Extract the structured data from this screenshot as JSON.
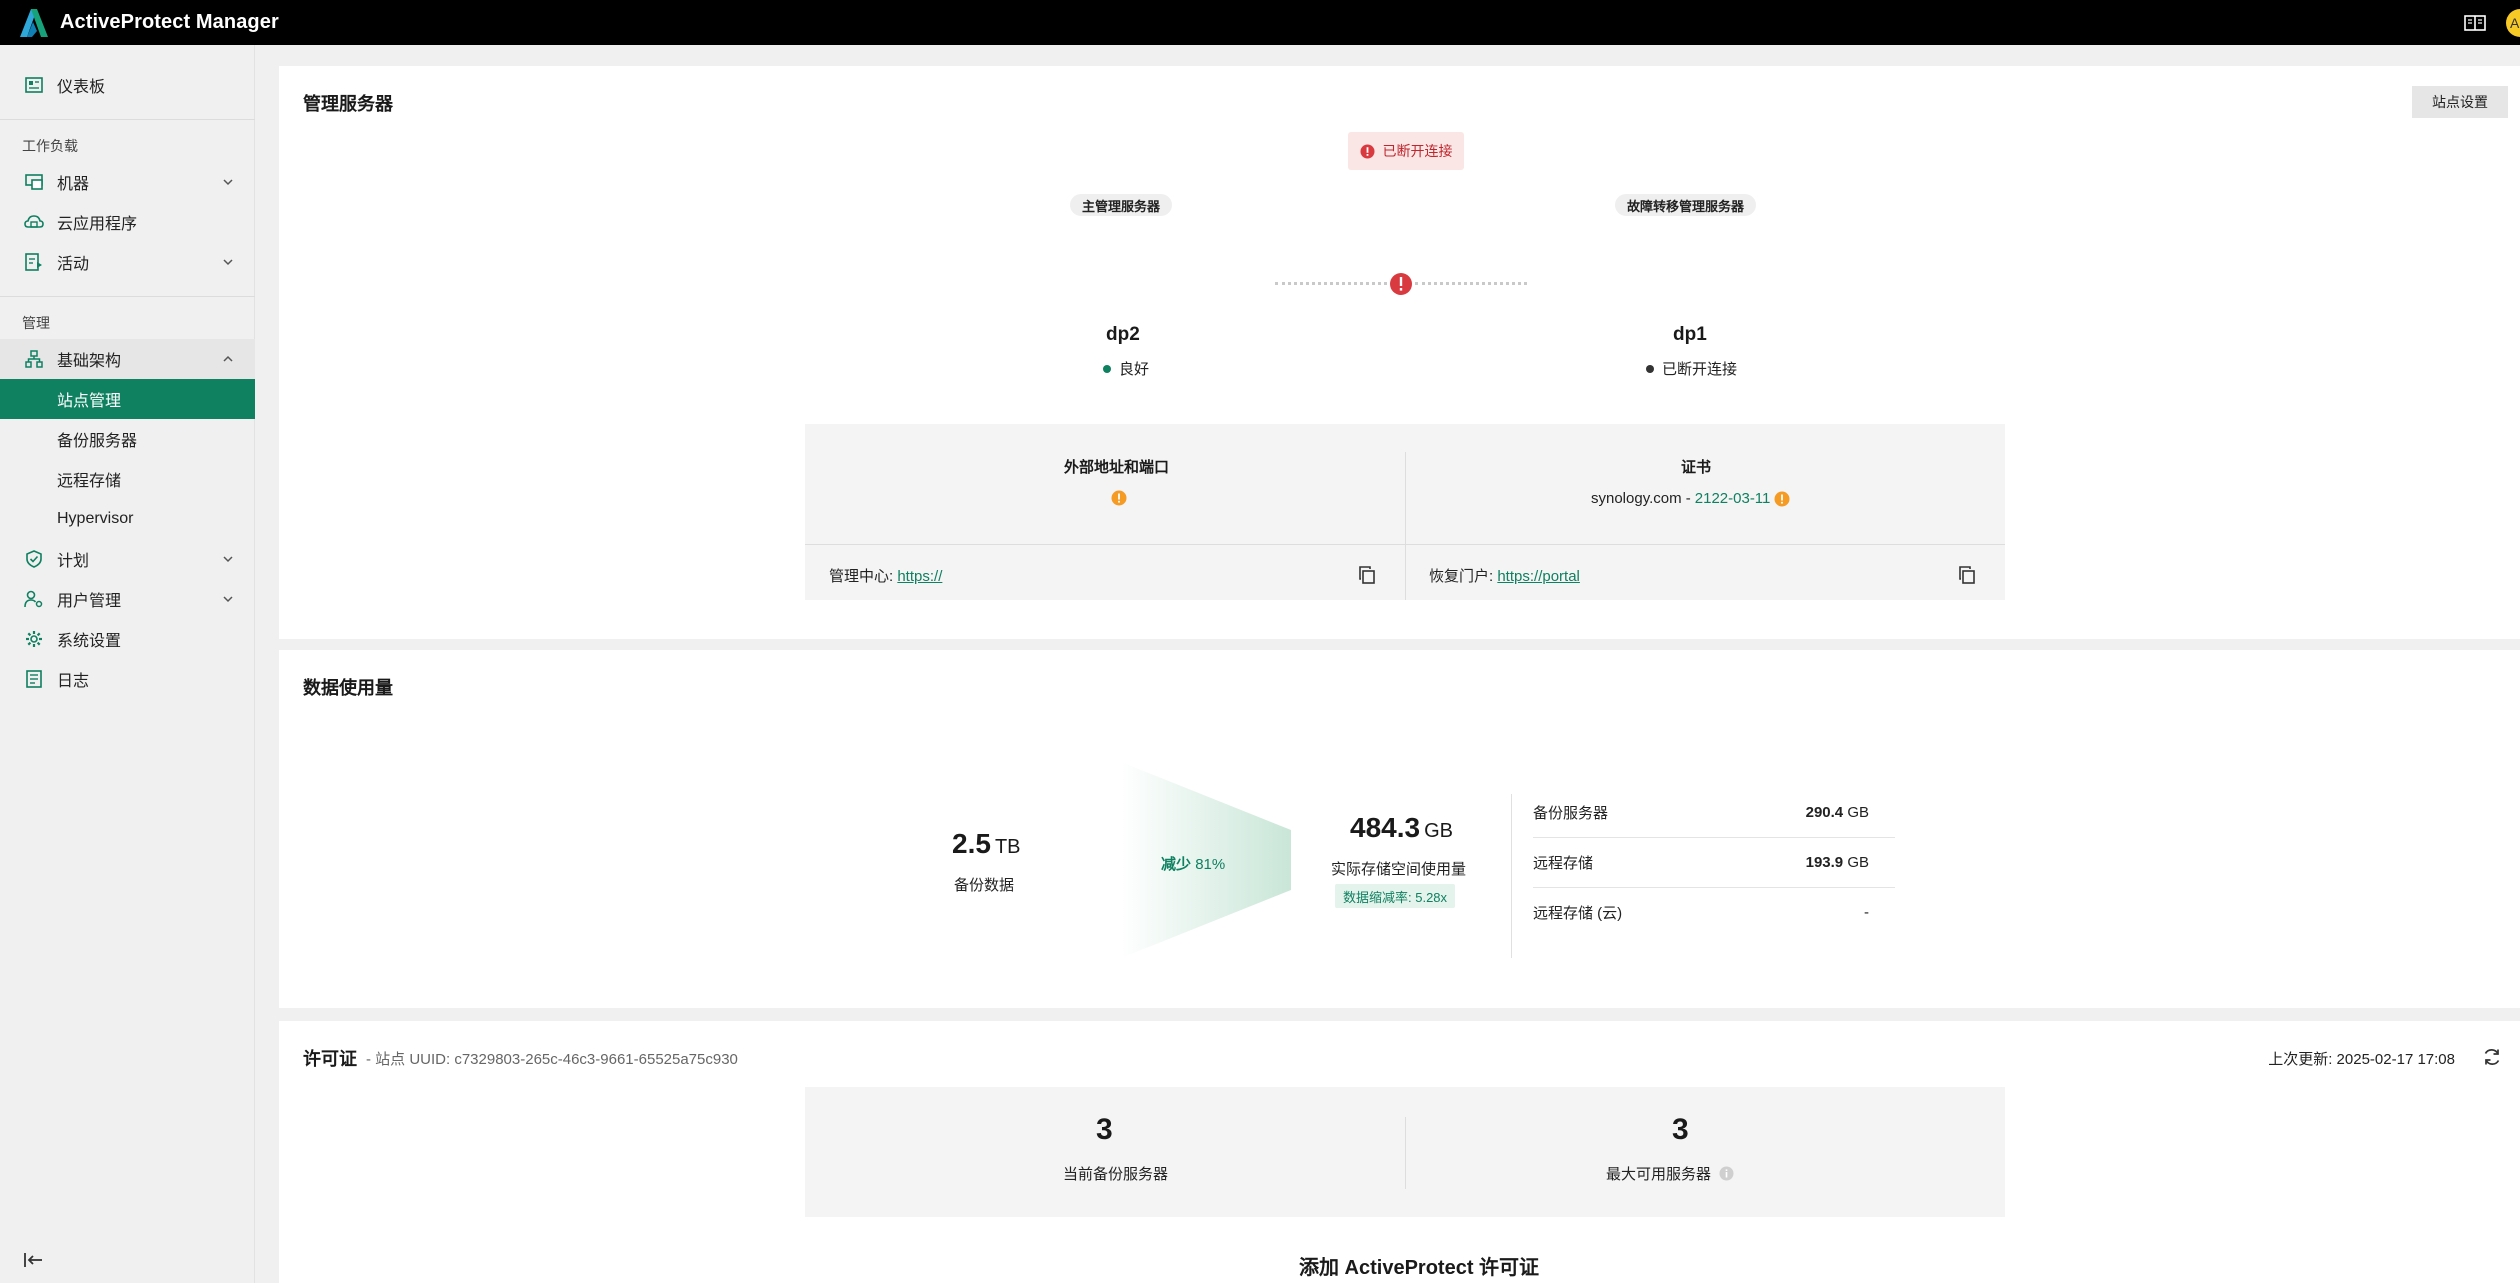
{
  "app": {
    "title": "ActiveProtect Manager",
    "avatar_initial": "A"
  },
  "colors": {
    "brand": "#0f8060",
    "error": "#d93a3f",
    "warning": "#f59a23",
    "topbar": "#000000"
  },
  "sidebar": {
    "dashboard": "仪表板",
    "section_workload": "工作负载",
    "machines": "机器",
    "cloud_apps": "云应用程序",
    "activities": "活动",
    "section_manage": "管理",
    "infrastructure": "基础架构",
    "site_management": "站点管理",
    "backup_servers": "备份服务器",
    "remote_storage": "远程存储",
    "hypervisor": "Hypervisor",
    "plans": "计划",
    "user_management": "用户管理",
    "system_settings": "系统设置",
    "logs": "日志"
  },
  "management_server": {
    "title": "管理服务器",
    "site_settings_button": "站点设置",
    "connection_status": "已断开连接",
    "primary_label": "主管理服务器",
    "failover_label": "故障转移管理服务器",
    "primary": {
      "name": "dp2",
      "status": "良好"
    },
    "failover": {
      "name": "dp1",
      "status": "已断开连接"
    },
    "external_address_label": "外部地址和端口",
    "certificate_label": "证书",
    "certificate_domain": "synology.com - ",
    "certificate_date": "2122-03-11",
    "admin_center_label": "管理中心: ",
    "admin_center_url": "https://",
    "recovery_portal_label": "恢复门户: ",
    "recovery_portal_url": "https://portal"
  },
  "data_usage": {
    "title": "数据使用量",
    "backup_data_value": "2.5",
    "backup_data_unit": "TB",
    "backup_data_label": "备份数据",
    "reduction_label": "减少",
    "reduction_value": "81%",
    "actual_value": "484.3",
    "actual_unit": "GB",
    "actual_label": "实际存储空间使用量",
    "ratio_label": "数据缩减率: 5.28x",
    "rows": [
      {
        "label": "备份服务器",
        "value": "290.4",
        "unit": " GB"
      },
      {
        "label": "远程存储",
        "value": "193.9",
        "unit": " GB"
      },
      {
        "label": "远程存储 (云)",
        "value": "-",
        "unit": ""
      }
    ]
  },
  "license": {
    "title": "许可证",
    "uuid_text": "- 站点 UUID: c7329803-265c-46c3-9661-65525a75c930",
    "last_updated": "上次更新: 2025-02-17 17:08",
    "current_servers_value": "3",
    "current_servers_label": "当前备份服务器",
    "max_servers_value": "3",
    "max_servers_label": "最大可用服务器",
    "add_license": "添加 ActiveProtect 许可证"
  }
}
